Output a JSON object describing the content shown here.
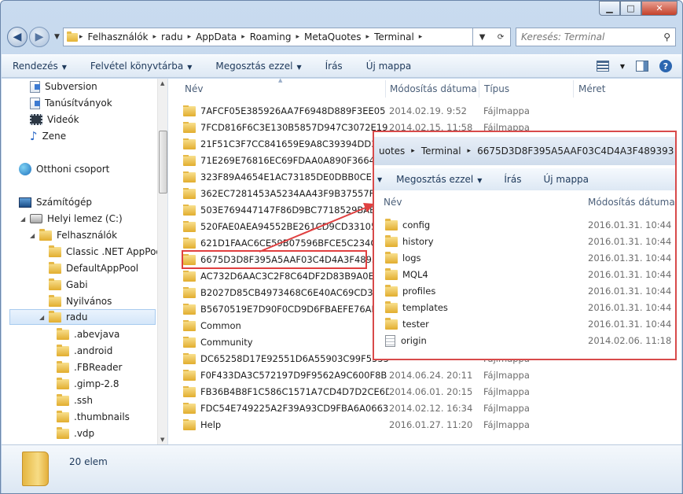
{
  "address": {
    "segments": [
      "Felhasználók",
      "radu",
      "AppData",
      "Roaming",
      "MetaQuotes",
      "Terminal"
    ],
    "search_placeholder": "Keresés: Terminal"
  },
  "toolbar": {
    "organize": "Rendezés",
    "add_library": "Felvétel könyvtárba",
    "share": "Megosztás ezzel",
    "burn": "Írás",
    "new_folder": "Új mappa"
  },
  "nav": {
    "items": [
      {
        "label": "Subversion",
        "icon": "document-library-icon"
      },
      {
        "label": "Tanúsítványok",
        "icon": "document-library-icon"
      },
      {
        "label": "Videók",
        "icon": "video-library-icon"
      },
      {
        "label": "Zene",
        "icon": "music-library-icon"
      },
      {
        "label": "Otthoni csoport",
        "icon": "homegroup-icon"
      },
      {
        "label": "Számítógép",
        "icon": "computer-icon"
      },
      {
        "label": "Helyi lemez (C:)",
        "icon": "drive-icon"
      },
      {
        "label": "Felhasználók",
        "icon": "folder-icon"
      },
      {
        "label": "Classic .NET AppPool",
        "icon": "folder-icon"
      },
      {
        "label": "DefaultAppPool",
        "icon": "folder-icon"
      },
      {
        "label": "Gabi",
        "icon": "folder-icon"
      },
      {
        "label": "Nyilvános",
        "icon": "folder-icon"
      },
      {
        "label": "radu",
        "icon": "folder-icon"
      },
      {
        "label": ".abevjava",
        "icon": "folder-icon"
      },
      {
        "label": ".android",
        "icon": "folder-icon"
      },
      {
        "label": ".FBReader",
        "icon": "folder-icon"
      },
      {
        "label": ".gimp-2.8",
        "icon": "folder-icon"
      },
      {
        "label": ".ssh",
        "icon": "folder-icon"
      },
      {
        "label": ".thumbnails",
        "icon": "folder-icon"
      },
      {
        "label": ".vdp",
        "icon": "folder-icon"
      }
    ]
  },
  "columns": {
    "name": "Név",
    "date": "Módosítás dátuma",
    "type": "Típus",
    "size": "Méret"
  },
  "files": [
    {
      "name": "7AFCF05E385926AA7F6948D889F3EE05",
      "date": "2014.02.19. 9:52",
      "type": "Fájlmappa"
    },
    {
      "name": "7FCD816F6C3E130B5857D947C3072E19",
      "date": "2014.02.15. 11:58",
      "type": "Fájlmappa"
    },
    {
      "name": "21F51C3F7CC841659E9A8C39394DD381",
      "date": "",
      "type": ""
    },
    {
      "name": "71E269E76816EC69FDAA0A890F366473",
      "date": "",
      "type": ""
    },
    {
      "name": "323F89A4654E1AC73185DE0DBB0CEED4",
      "date": "",
      "type": ""
    },
    {
      "name": "362EC7281453A5234AA43F9B37557F1B",
      "date": "",
      "type": ""
    },
    {
      "name": "503E769447147F86D9BC7718529BAB1F",
      "date": "",
      "type": ""
    },
    {
      "name": "520FAE0AEA94552BE261CD9CD33105AC",
      "date": "",
      "type": ""
    },
    {
      "name": "621D1FAAC6CE59B07596BFCE5C234C4E",
      "date": "",
      "type": ""
    },
    {
      "name": "6675D3D8F395A5AAF03C4D4A3F489393",
      "date": "",
      "type": ""
    },
    {
      "name": "AC732D6AAC3C2F8C64DF2D83B9A0E6CF",
      "date": "",
      "type": ""
    },
    {
      "name": "B2027D85CB4973468C6E40AC69CD3EFF",
      "date": "",
      "type": ""
    },
    {
      "name": "B5670519E7D90F0CD9D6FBAEFE76AF17",
      "date": "",
      "type": ""
    },
    {
      "name": "Common",
      "date": "",
      "type": ""
    },
    {
      "name": "Community",
      "date": "",
      "type": ""
    },
    {
      "name": "DC65258D17E92551D6A55903C99F5555",
      "date": "",
      "type": "Fájlmappa"
    },
    {
      "name": "F0F433DA3C572197D9F9562A9C600F8B",
      "date": "2014.06.24. 20:11",
      "type": "Fájlmappa"
    },
    {
      "name": "FB36B4B8F1C586C1571A7CD4D7D2CE6D",
      "date": "2014.06.01. 20:15",
      "type": "Fájlmappa"
    },
    {
      "name": "FDC54E749225A2F39A93CD9FBA6A0663",
      "date": "2014.02.12. 16:34",
      "type": "Fájlmappa"
    },
    {
      "name": "Help",
      "date": "2016.01.27. 11:20",
      "type": "Fájlmappa"
    }
  ],
  "status": {
    "count": "20 elem"
  },
  "overlay": {
    "address": [
      "uotes",
      "Terminal",
      "6675D3D8F395A5AAF03C4D4A3F489393"
    ],
    "toolbar": {
      "share": "Megosztás ezzel",
      "burn": "Írás",
      "new_folder": "Új mappa"
    },
    "columns": {
      "name": "Név",
      "date": "Módosítás dátuma"
    },
    "files": [
      {
        "name": "config",
        "date": "2016.01.31. 10:44",
        "kind": "folder"
      },
      {
        "name": "history",
        "date": "2016.01.31. 10:44",
        "kind": "folder"
      },
      {
        "name": "logs",
        "date": "2016.01.31. 10:44",
        "kind": "folder"
      },
      {
        "name": "MQL4",
        "date": "2016.01.31. 10:44",
        "kind": "folder"
      },
      {
        "name": "profiles",
        "date": "2016.01.31. 10:44",
        "kind": "folder"
      },
      {
        "name": "templates",
        "date": "2016.01.31. 10:44",
        "kind": "folder"
      },
      {
        "name": "tester",
        "date": "2016.01.31. 10:44",
        "kind": "folder"
      },
      {
        "name": "origin",
        "date": "2014.02.06. 11:18",
        "kind": "file"
      }
    ]
  },
  "colors": {
    "highlight": "#e04040",
    "selection": "#d4e6f9"
  }
}
